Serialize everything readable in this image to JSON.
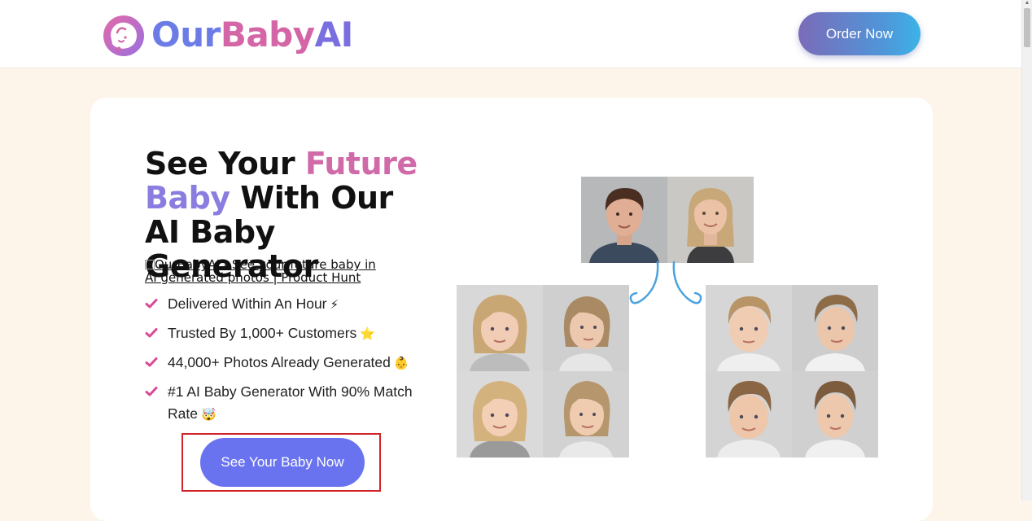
{
  "header": {
    "logo": {
      "our": "Our",
      "baby": "Baby",
      "ai": "AI"
    },
    "order_button": "Order Now"
  },
  "hero": {
    "headline": {
      "part1": "See Your ",
      "accent1": "Future",
      "accent2": "Baby",
      "part2": " With Our AI Baby Generator"
    },
    "product_hunt_alt": "OurBabyAI - See your future baby in AI generated photos | Product Hunt",
    "features": [
      {
        "text": "Delivered Within An Hour",
        "emoji": "⚡"
      },
      {
        "text": "Trusted By 1,000+ Customers",
        "emoji": "⭐"
      },
      {
        "text": "44,000+ Photos Already Generated",
        "emoji": "👶"
      },
      {
        "text": "#1 AI Baby Generator With 90% Match Rate",
        "emoji": "🤯"
      }
    ],
    "cta_button": "See Your Baby Now"
  },
  "colors": {
    "accent_pink": "#d06aa8",
    "accent_purple": "#8a7de0",
    "cta": "#6973f0",
    "check": "#d84a96",
    "highlight_box": "#d1242a"
  }
}
